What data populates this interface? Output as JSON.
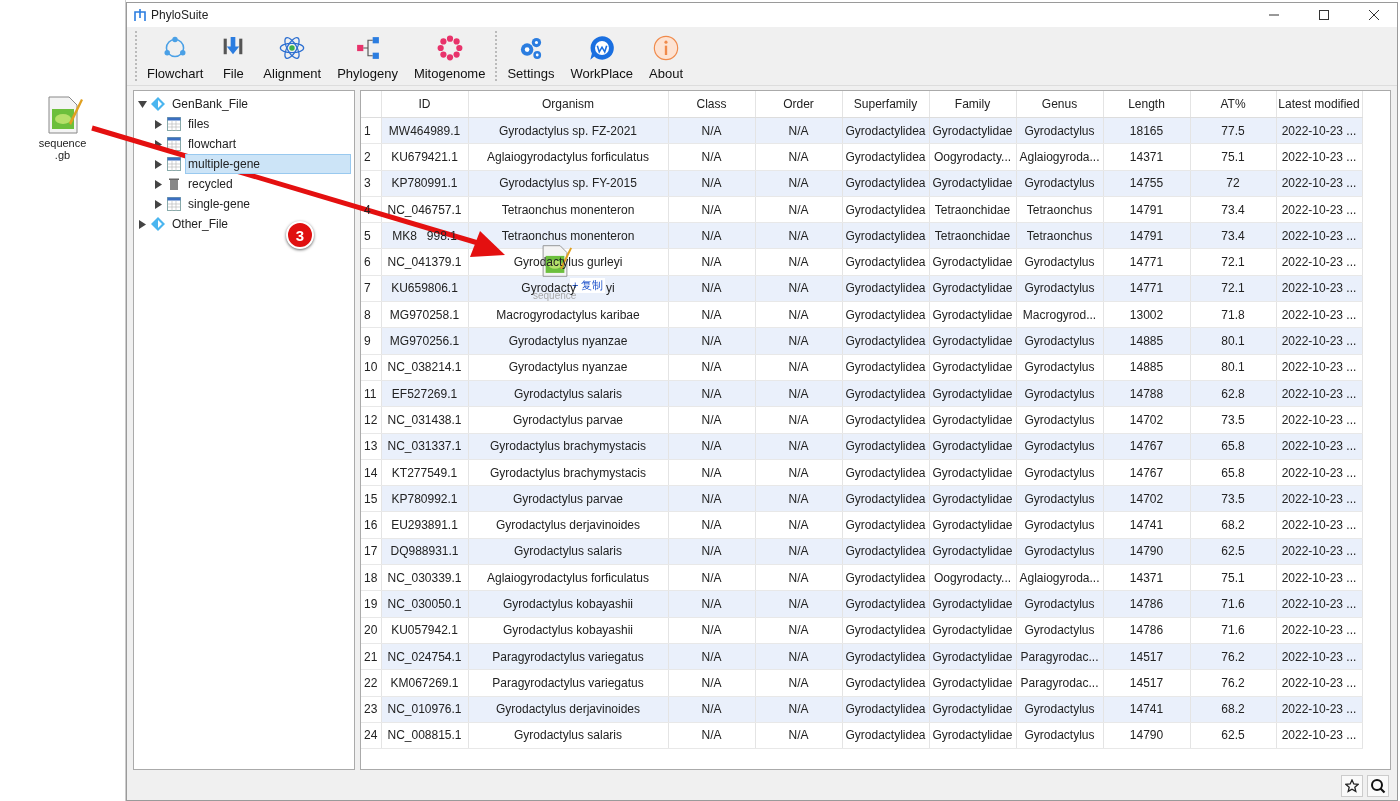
{
  "desktop": {
    "file_label": "sequence .gb"
  },
  "window": {
    "title": "PhyloSuite"
  },
  "toolbar": [
    {
      "kind": "flowchart",
      "label": "Flowchart"
    },
    {
      "kind": "file",
      "label": "File"
    },
    {
      "kind": "alignment",
      "label": "Alignment"
    },
    {
      "kind": "phylogeny",
      "label": "Phylogeny"
    },
    {
      "kind": "mitogenome",
      "label": "Mitogenome"
    },
    {
      "kind": "settings",
      "label": "Settings"
    },
    {
      "kind": "workplace",
      "label": "WorkPlace"
    },
    {
      "kind": "about",
      "label": "About"
    }
  ],
  "tree": [
    {
      "label": "GenBank_File",
      "expanded": true,
      "selected": false,
      "children": [
        {
          "label": "files",
          "kind": "table",
          "selected": false
        },
        {
          "label": "flowchart",
          "kind": "table",
          "selected": false
        },
        {
          "label": "multiple-gene",
          "kind": "table",
          "selected": true
        },
        {
          "label": "recycled",
          "kind": "trash",
          "selected": false
        },
        {
          "label": "single-gene",
          "kind": "table",
          "selected": false
        }
      ]
    },
    {
      "label": "Other_File",
      "expanded": false,
      "selected": false
    }
  ],
  "table": {
    "columns": [
      "",
      "ID",
      "Organism",
      "Class",
      "Order",
      "Superfamily",
      "Family",
      "Genus",
      "Length",
      "AT%",
      "Latest modified"
    ],
    "rows": [
      [
        "1",
        "MW464989.1",
        "Gyrodactylus sp. FZ-2021",
        "N/A",
        "N/A",
        "Gyrodactylidea",
        "Gyrodactylidae",
        "Gyrodactylus",
        "18165",
        "77.5",
        "2022-10-23 ..."
      ],
      [
        "2",
        "KU679421.1",
        "Aglaiogyrodactylus forficulatus",
        "N/A",
        "N/A",
        "Gyrodactylidea",
        "Oogyrodacty...",
        "Aglaiogyroda...",
        "14371",
        "75.1",
        "2022-10-23 ..."
      ],
      [
        "3",
        "KP780991.1",
        "Gyrodactylus sp. FY-2015",
        "N/A",
        "N/A",
        "Gyrodactylidea",
        "Gyrodactylidae",
        "Gyrodactylus",
        "14755",
        "72",
        "2022-10-23 ..."
      ],
      [
        "4",
        "NC_046757.1",
        "Tetraonchus monenteron",
        "N/A",
        "N/A",
        "Gyrodactylidea",
        "Tetraonchidae",
        "Tetraonchus",
        "14791",
        "73.4",
        "2022-10-23 ..."
      ],
      [
        "5",
        "MK8   998.1",
        "Tetraonchus monenteron",
        "N/A",
        "N/A",
        "Gyrodactylidea",
        "Tetraonchidae",
        "Tetraonchus",
        "14791",
        "73.4",
        "2022-10-23 ..."
      ],
      [
        "6",
        "NC_041379.1",
        "Gyrodactylus gurleyi",
        "N/A",
        "N/A",
        "Gyrodactylidea",
        "Gyrodactylidae",
        "Gyrodactylus",
        "14771",
        "72.1",
        "2022-10-23 ..."
      ],
      [
        "7",
        "KU659806.1",
        "Gyrodacty         yi",
        "N/A",
        "N/A",
        "Gyrodactylidea",
        "Gyrodactylidae",
        "Gyrodactylus",
        "14771",
        "72.1",
        "2022-10-23 ..."
      ],
      [
        "8",
        "MG970258.1",
        "Macrogyrodactylus karibae",
        "N/A",
        "N/A",
        "Gyrodactylidea",
        "Gyrodactylidae",
        "Macrogyrod...",
        "13002",
        "71.8",
        "2022-10-23 ..."
      ],
      [
        "9",
        "MG970256.1",
        "Gyrodactylus nyanzae",
        "N/A",
        "N/A",
        "Gyrodactylidea",
        "Gyrodactylidae",
        "Gyrodactylus",
        "14885",
        "80.1",
        "2022-10-23 ..."
      ],
      [
        "10",
        "NC_038214.1",
        "Gyrodactylus nyanzae",
        "N/A",
        "N/A",
        "Gyrodactylidea",
        "Gyrodactylidae",
        "Gyrodactylus",
        "14885",
        "80.1",
        "2022-10-23 ..."
      ],
      [
        "11",
        "EF527269.1",
        "Gyrodactylus salaris",
        "N/A",
        "N/A",
        "Gyrodactylidea",
        "Gyrodactylidae",
        "Gyrodactylus",
        "14788",
        "62.8",
        "2022-10-23 ..."
      ],
      [
        "12",
        "NC_031438.1",
        "Gyrodactylus parvae",
        "N/A",
        "N/A",
        "Gyrodactylidea",
        "Gyrodactylidae",
        "Gyrodactylus",
        "14702",
        "73.5",
        "2022-10-23 ..."
      ],
      [
        "13",
        "NC_031337.1",
        "Gyrodactylus brachymystacis",
        "N/A",
        "N/A",
        "Gyrodactylidea",
        "Gyrodactylidae",
        "Gyrodactylus",
        "14767",
        "65.8",
        "2022-10-23 ..."
      ],
      [
        "14",
        "KT277549.1",
        "Gyrodactylus brachymystacis",
        "N/A",
        "N/A",
        "Gyrodactylidea",
        "Gyrodactylidae",
        "Gyrodactylus",
        "14767",
        "65.8",
        "2022-10-23 ..."
      ],
      [
        "15",
        "KP780992.1",
        "Gyrodactylus parvae",
        "N/A",
        "N/A",
        "Gyrodactylidea",
        "Gyrodactylidae",
        "Gyrodactylus",
        "14702",
        "73.5",
        "2022-10-23 ..."
      ],
      [
        "16",
        "EU293891.1",
        "Gyrodactylus derjavinoides",
        "N/A",
        "N/A",
        "Gyrodactylidea",
        "Gyrodactylidae",
        "Gyrodactylus",
        "14741",
        "68.2",
        "2022-10-23 ..."
      ],
      [
        "17",
        "DQ988931.1",
        "Gyrodactylus salaris",
        "N/A",
        "N/A",
        "Gyrodactylidea",
        "Gyrodactylidae",
        "Gyrodactylus",
        "14790",
        "62.5",
        "2022-10-23 ..."
      ],
      [
        "18",
        "NC_030339.1",
        "Aglaiogyrodactylus forficulatus",
        "N/A",
        "N/A",
        "Gyrodactylidea",
        "Oogyrodacty...",
        "Aglaiogyroda...",
        "14371",
        "75.1",
        "2022-10-23 ..."
      ],
      [
        "19",
        "NC_030050.1",
        "Gyrodactylus kobayashii",
        "N/A",
        "N/A",
        "Gyrodactylidea",
        "Gyrodactylidae",
        "Gyrodactylus",
        "14786",
        "71.6",
        "2022-10-23 ..."
      ],
      [
        "20",
        "KU057942.1",
        "Gyrodactylus kobayashii",
        "N/A",
        "N/A",
        "Gyrodactylidea",
        "Gyrodactylidae",
        "Gyrodactylus",
        "14786",
        "71.6",
        "2022-10-23 ..."
      ],
      [
        "21",
        "NC_024754.1",
        "Paragyrodactylus variegatus",
        "N/A",
        "N/A",
        "Gyrodactylidea",
        "Gyrodactylidae",
        "Paragyrodac...",
        "14517",
        "76.2",
        "2022-10-23 ..."
      ],
      [
        "22",
        "KM067269.1",
        "Paragyrodactylus variegatus",
        "N/A",
        "N/A",
        "Gyrodactylidea",
        "Gyrodactylidae",
        "Paragyrodac...",
        "14517",
        "76.2",
        "2022-10-23 ..."
      ],
      [
        "23",
        "NC_010976.1",
        "Gyrodactylus derjavinoides",
        "N/A",
        "N/A",
        "Gyrodactylidea",
        "Gyrodactylidae",
        "Gyrodactylus",
        "14741",
        "68.2",
        "2022-10-23 ..."
      ],
      [
        "24",
        "NC_008815.1",
        "Gyrodactylus salaris",
        "N/A",
        "N/A",
        "Gyrodactylidea",
        "Gyrodactylidae",
        "Gyrodactylus",
        "14790",
        "62.5",
        "2022-10-23 ..."
      ]
    ]
  },
  "annotation": {
    "step_badge": "3",
    "drag_action": "+ 复制",
    "drag_label": "sequence"
  }
}
